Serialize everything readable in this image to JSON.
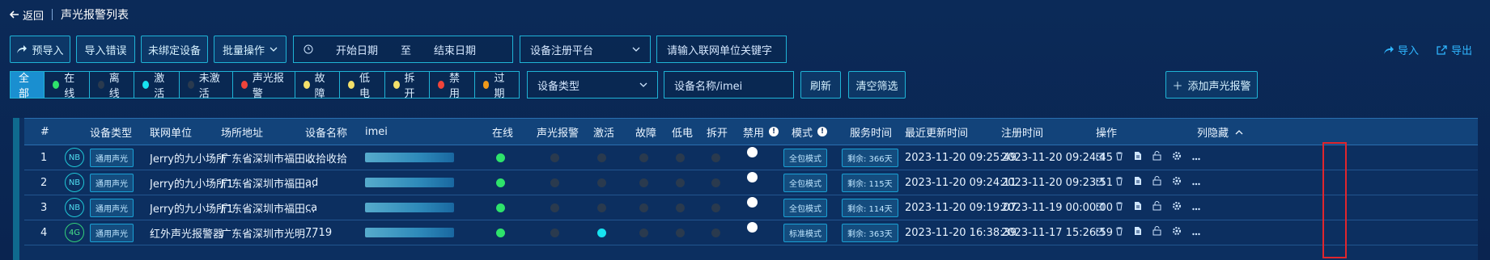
{
  "header": {
    "back_label": "返回",
    "title": "声光报警列表"
  },
  "toolbar": {
    "preimport": "预导入",
    "import_error": "导入错误",
    "unbound": "未绑定设备",
    "batch": "批量操作",
    "date_start": "开始日期",
    "date_to": "至",
    "date_end": "结束日期",
    "platform": "设备注册平台",
    "search_placeholder": "请输入联网单位关键字",
    "import": "导入",
    "export": "导出"
  },
  "filters": {
    "status_items": [
      {
        "label": "全部",
        "color": ""
      },
      {
        "label": "在线",
        "color": "#2ee36b"
      },
      {
        "label": "离线",
        "color": "#2a3a4e"
      },
      {
        "label": "激活",
        "color": "#17e3f0"
      },
      {
        "label": "未激活",
        "color": "#2a3a4e"
      },
      {
        "label": "声光报警",
        "color": "#f0443a"
      },
      {
        "label": "故障",
        "color": "#f4e06a"
      },
      {
        "label": "低电",
        "color": "#f4e06a"
      },
      {
        "label": "拆开",
        "color": "#f4e06a"
      },
      {
        "label": "禁用",
        "color": "#f0443a"
      },
      {
        "label": "过期",
        "color": "#f09a1a"
      }
    ],
    "device_type": "设备类型",
    "device_name_placeholder": "设备名称/imei",
    "refresh": "刷新",
    "clear": "清空筛选",
    "add": "添加声光报警"
  },
  "table": {
    "columns": [
      "#",
      "设备类型",
      "联网单位",
      "场所地址",
      "设备名称",
      "imei",
      "在线",
      "声光报警",
      "激活",
      "故障",
      "低电",
      "拆开",
      "禁用",
      "模式",
      "服务时间",
      "最近更新时间",
      "注册时间",
      "操作",
      "列隐藏"
    ],
    "rows": [
      {
        "no": "1",
        "net": "NB",
        "type": "通用声光",
        "unit": "Jerry的九小场所",
        "address": "广东省深圳市福田...",
        "name": "收拾收拾",
        "mode": "全包模式",
        "service": "剩余: 366天",
        "updated": "2023-11-20 09:25:49",
        "registered": "2023-11-20 09:24:45",
        "active": false
      },
      {
        "no": "2",
        "net": "NB",
        "type": "通用声光",
        "unit": "Jerry的九小场所1",
        "address": "广东省深圳市福田...",
        "name": "ad",
        "mode": "全包模式",
        "service": "剩余: 115天",
        "updated": "2023-11-20 09:24:11",
        "registered": "2023-11-20 09:23:51",
        "active": false
      },
      {
        "no": "3",
        "net": "NB",
        "type": "通用声光",
        "unit": "Jerry的九小场所1",
        "address": "广东省深圳市福田...",
        "name": "ca",
        "mode": "全包模式",
        "service": "剩余: 114天",
        "updated": "2023-11-20 09:19:07",
        "registered": "2023-11-19 00:00:00",
        "active": false
      },
      {
        "no": "4",
        "net": "4G",
        "type": "通用声光",
        "unit": "红外声光报警器",
        "address": "广东省深圳市光明...",
        "name": "7719",
        "mode": "标准模式",
        "service": "剩余: 363天",
        "updated": "2023-11-20 16:38:39",
        "registered": "2023-11-17 15:26:59",
        "active": true
      }
    ]
  },
  "colors": {
    "accent": "#1fb3d6",
    "online": "#2ee36b",
    "inactive": "#2a3a4e",
    "active": "#17e3f0",
    "highlight": "#e0262d"
  }
}
